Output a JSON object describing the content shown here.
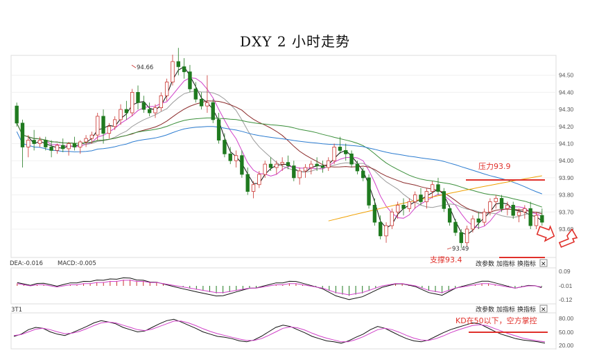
{
  "title": "DXY 2 小时走势",
  "colors": {
    "up": "#c9322e",
    "down": "#1f7a1f",
    "accent_red": "#e0302a",
    "ma_black": "#111111",
    "ma_pink": "#d040c8",
    "ma_gray": "#9a9a9a",
    "ma_brown": "#8b2a2a",
    "ma_green": "#3a8f3a",
    "ma_blue": "#2a7bd0",
    "ma_orange": "#f0a000"
  },
  "main_panel": {
    "y_ticks": [
      "94.50",
      "94.40",
      "94.30",
      "94.20",
      "94.10",
      "94.00",
      "93.90",
      "93.80",
      "93.70",
      "93.60"
    ],
    "high_label": "94.66",
    "low_label": "93.49",
    "resistance_label": "压力93.9",
    "support_label": "支撑93.4"
  },
  "macd_panel": {
    "header_dea": "DEA:-0.016",
    "header_macd": "MACD:-0.005",
    "y_ticks": [
      "0.09",
      "-0.01",
      "-0.12"
    ],
    "btn_params": "改参数",
    "btn_indicator": "加指标",
    "btn_switch": "换指标",
    "close_icon_text": "✕"
  },
  "kd_panel": {
    "header": "3T1",
    "y_ticks": [
      "80.00",
      "50.00",
      "20.00"
    ],
    "btn_params": "改参数",
    "btn_indicator": "加指标",
    "btn_switch": "换指标",
    "close_icon_text": "✕",
    "annotation": "KD在50以下，空方掌控"
  },
  "chart_data": {
    "type": "candlestick",
    "ylim": [
      93.45,
      94.6
    ],
    "ohlc": [
      [
        94.32,
        94.34,
        94.2,
        94.22
      ],
      [
        94.22,
        94.24,
        93.96,
        94.08
      ],
      [
        94.08,
        94.15,
        94.02,
        94.12
      ],
      [
        94.12,
        94.18,
        94.06,
        94.1
      ],
      [
        94.1,
        94.14,
        94.08,
        94.12
      ],
      [
        94.12,
        94.14,
        94.06,
        94.08
      ],
      [
        94.08,
        94.12,
        94.02,
        94.06
      ],
      [
        94.06,
        94.1,
        94.04,
        94.09
      ],
      [
        94.09,
        94.13,
        94.05,
        94.07
      ],
      [
        94.07,
        94.11,
        94.03,
        94.1
      ],
      [
        94.1,
        94.14,
        94.06,
        94.08
      ],
      [
        94.08,
        94.12,
        94.04,
        94.11
      ],
      [
        94.11,
        94.15,
        94.08,
        94.13
      ],
      [
        94.13,
        94.17,
        94.1,
        94.15
      ],
      [
        94.15,
        94.28,
        94.12,
        94.26
      ],
      [
        94.26,
        94.3,
        94.1,
        94.16
      ],
      [
        94.16,
        94.22,
        94.13,
        94.2
      ],
      [
        94.2,
        94.26,
        94.18,
        94.24
      ],
      [
        94.24,
        94.33,
        94.21,
        94.3
      ],
      [
        94.3,
        94.35,
        94.24,
        94.28
      ],
      [
        94.28,
        94.42,
        94.26,
        94.4
      ],
      [
        94.4,
        94.44,
        94.3,
        94.34
      ],
      [
        94.34,
        94.38,
        94.28,
        94.3
      ],
      [
        94.3,
        94.34,
        94.26,
        94.28
      ],
      [
        94.28,
        94.33,
        94.25,
        94.31
      ],
      [
        94.31,
        94.4,
        94.29,
        94.38
      ],
      [
        94.38,
        94.48,
        94.35,
        94.46
      ],
      [
        94.46,
        94.62,
        94.44,
        94.58
      ],
      [
        94.58,
        94.66,
        94.5,
        94.55
      ],
      [
        94.55,
        94.6,
        94.48,
        94.52
      ],
      [
        94.52,
        94.56,
        94.4,
        94.42
      ],
      [
        94.42,
        94.46,
        94.34,
        94.36
      ],
      [
        94.36,
        94.4,
        94.3,
        94.32
      ],
      [
        94.32,
        94.5,
        94.28,
        94.34
      ],
      [
        94.34,
        94.36,
        94.22,
        94.24
      ],
      [
        94.24,
        94.28,
        94.1,
        94.12
      ],
      [
        94.12,
        94.16,
        94.02,
        94.04
      ],
      [
        94.04,
        94.08,
        93.98,
        94.0
      ],
      [
        94.0,
        94.06,
        93.96,
        94.03
      ],
      [
        94.03,
        94.06,
        93.9,
        93.92
      ],
      [
        93.92,
        93.96,
        93.8,
        93.82
      ],
      [
        93.82,
        93.88,
        93.78,
        93.86
      ],
      [
        93.86,
        93.94,
        93.84,
        93.92
      ],
      [
        93.92,
        94.0,
        93.9,
        93.98
      ],
      [
        93.98,
        94.02,
        93.94,
        93.96
      ],
      [
        93.96,
        94.0,
        93.92,
        93.98
      ],
      [
        93.98,
        94.02,
        93.94,
        93.99
      ],
      [
        93.99,
        94.03,
        93.95,
        93.97
      ],
      [
        93.97,
        94.0,
        93.88,
        93.9
      ],
      [
        93.9,
        93.96,
        93.86,
        93.94
      ],
      [
        93.94,
        93.98,
        93.9,
        93.96
      ],
      [
        93.96,
        94.0,
        93.92,
        93.98
      ],
      [
        93.98,
        94.02,
        93.94,
        93.97
      ],
      [
        93.97,
        94.0,
        93.93,
        93.96
      ],
      [
        93.96,
        94.02,
        93.94,
        94.0
      ],
      [
        94.0,
        94.1,
        93.98,
        94.08
      ],
      [
        94.08,
        94.14,
        94.04,
        94.06
      ],
      [
        94.06,
        94.1,
        94.0,
        94.04
      ],
      [
        94.04,
        94.06,
        93.96,
        93.98
      ],
      [
        93.98,
        94.0,
        93.92,
        93.94
      ],
      [
        93.94,
        93.96,
        93.88,
        93.9
      ],
      [
        93.9,
        93.92,
        93.72,
        93.74
      ],
      [
        93.74,
        93.78,
        93.62,
        93.64
      ],
      [
        93.64,
        93.68,
        93.54,
        93.56
      ],
      [
        93.56,
        93.64,
        93.52,
        93.62
      ],
      [
        93.62,
        93.72,
        93.6,
        93.7
      ],
      [
        93.7,
        93.76,
        93.66,
        93.74
      ],
      [
        93.74,
        93.78,
        93.68,
        93.72
      ],
      [
        93.72,
        93.78,
        93.7,
        93.76
      ],
      [
        93.76,
        93.82,
        93.72,
        93.8
      ],
      [
        93.8,
        93.84,
        93.74,
        93.76
      ],
      [
        93.76,
        93.84,
        93.72,
        93.82
      ],
      [
        93.82,
        93.88,
        93.78,
        93.86
      ],
      [
        93.86,
        93.9,
        93.8,
        93.82
      ],
      [
        93.82,
        93.84,
        93.7,
        93.72
      ],
      [
        93.72,
        93.74,
        93.62,
        93.64
      ],
      [
        93.64,
        93.66,
        93.56,
        93.58
      ],
      [
        93.58,
        93.6,
        93.49,
        93.52
      ],
      [
        93.52,
        93.62,
        93.5,
        93.6
      ],
      [
        93.6,
        93.68,
        93.58,
        93.66
      ],
      [
        93.66,
        93.7,
        93.6,
        93.64
      ],
      [
        93.64,
        93.72,
        93.62,
        93.7
      ],
      [
        93.7,
        93.78,
        93.68,
        93.76
      ],
      [
        93.76,
        93.8,
        93.72,
        93.78
      ],
      [
        93.78,
        93.8,
        93.7,
        93.72
      ],
      [
        93.72,
        93.76,
        93.68,
        93.74
      ],
      [
        93.74,
        93.76,
        93.66,
        93.68
      ],
      [
        93.68,
        93.72,
        93.64,
        93.7
      ],
      [
        93.7,
        93.74,
        93.66,
        93.72
      ],
      [
        93.72,
        93.76,
        93.6,
        93.62
      ],
      [
        93.62,
        93.7,
        93.6,
        93.68
      ],
      [
        93.68,
        93.72,
        93.62,
        93.64
      ]
    ],
    "macd_hist": [
      0.02,
      0.01,
      0.0,
      0.01,
      0.01,
      0.0,
      -0.01,
      0.0,
      0.01,
      0.01,
      0.02,
      0.02,
      0.03,
      0.03,
      0.04,
      0.04,
      0.05,
      0.05,
      0.04,
      0.04,
      0.03,
      0.03,
      0.02,
      0.01,
      0.0,
      -0.01,
      -0.02,
      -0.03,
      -0.04,
      -0.05,
      -0.06,
      -0.06,
      -0.05,
      -0.04,
      -0.03,
      -0.02,
      -0.02,
      -0.01,
      0.0,
      0.01,
      0.01,
      0.02,
      0.02,
      0.01,
      0.0,
      -0.01,
      -0.02,
      -0.04,
      -0.06,
      -0.07,
      -0.08,
      -0.07,
      -0.06,
      -0.04,
      -0.02,
      0.0,
      0.01,
      0.02,
      0.02,
      0.01,
      0.0,
      -0.02,
      -0.04,
      -0.05,
      -0.06,
      -0.04,
      -0.02,
      -0.01,
      0.0,
      0.01,
      0.02,
      0.02,
      0.01,
      0.0,
      -0.01,
      -0.02,
      -0.01,
      0.0,
      0.0,
      -0.01
    ],
    "kd_k": [
      40,
      45,
      55,
      60,
      58,
      50,
      45,
      42,
      48,
      55,
      62,
      70,
      75,
      72,
      68,
      60,
      55,
      50,
      52,
      60,
      68,
      75,
      78,
      72,
      65,
      58,
      50,
      45,
      40,
      38,
      35,
      30,
      28,
      32,
      40,
      50,
      60,
      65,
      62,
      55,
      48,
      40,
      35,
      30,
      28,
      25,
      30,
      38,
      45,
      55,
      62,
      58,
      50,
      42,
      35,
      30,
      28,
      32,
      40,
      48,
      55,
      60,
      65,
      70,
      68,
      60,
      52,
      45,
      40,
      35,
      32,
      30,
      28,
      25
    ],
    "kd_d": [
      42,
      44,
      50,
      56,
      58,
      55,
      50,
      46,
      47,
      51,
      57,
      64,
      70,
      72,
      70,
      65,
      60,
      55,
      53,
      56,
      62,
      68,
      74,
      74,
      70,
      64,
      57,
      51,
      46,
      42,
      38,
      34,
      31,
      31,
      35,
      42,
      50,
      58,
      61,
      59,
      54,
      47,
      41,
      36,
      32,
      28,
      28,
      33,
      39,
      47,
      55,
      58,
      55,
      49,
      42,
      36,
      32,
      31,
      35,
      41,
      48,
      54,
      59,
      64,
      66,
      64,
      58,
      52,
      46,
      41,
      36,
      33,
      30,
      28
    ]
  }
}
